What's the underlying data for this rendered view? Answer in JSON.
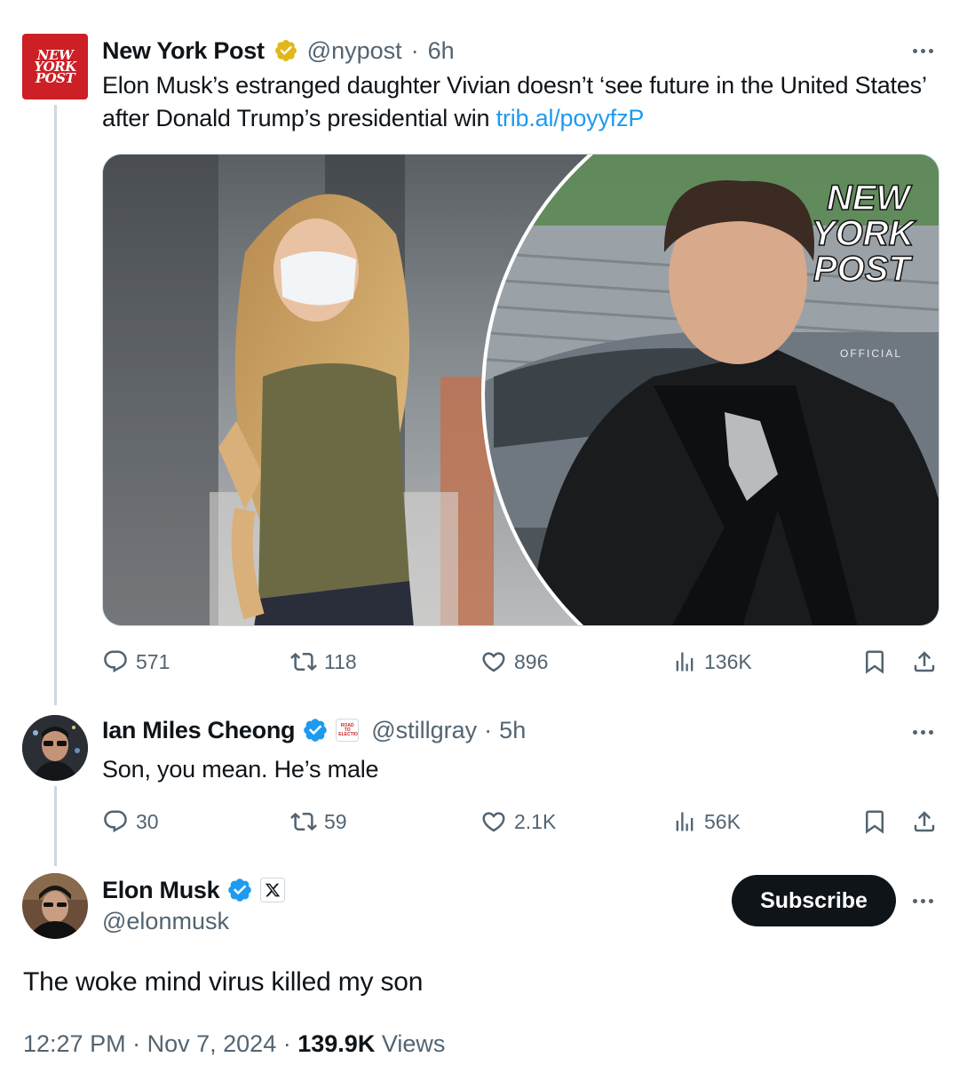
{
  "post1": {
    "display_name": "New York Post",
    "handle": "@nypost",
    "sep": "·",
    "time": "6h",
    "logo_text": [
      "NEW",
      "YORK",
      "POST"
    ],
    "text": "Elon Musk’s estranged daughter Vivian doesn’t ‘see future in the United States’ after Donald Trump’s presidential win ",
    "link": "trib.al/poyyfzP",
    "media_watermark": [
      "NEW",
      "YORK",
      "POST"
    ],
    "media_sign": "OFFICIAL",
    "replies": "571",
    "reposts": "118",
    "likes": "896",
    "views": "136K"
  },
  "post2": {
    "display_name": "Ian Miles Cheong",
    "affiliate_badge": "ROAD TO ELECTION",
    "handle": "@stillgray",
    "sep": "·",
    "time": "5h",
    "text": "Son, you mean. He’s male",
    "replies": "30",
    "reposts": "59",
    "likes": "2.1K",
    "views": "56K"
  },
  "post3": {
    "display_name": "Elon Musk",
    "handle": "@elonmusk",
    "subscribe_label": "Subscribe",
    "text": "The woke mind virus killed my son",
    "time": "12:27 PM",
    "sep": "·",
    "date": "Nov 7, 2024",
    "views_count": "139.9K",
    "views_label": "Views"
  },
  "colors": {
    "text": "#0f1419",
    "secondary": "#536471",
    "link": "#1d9bf0",
    "verified_gold": "#e2b719",
    "verified_blue": "#1d9bf0",
    "nypost_red": "#cc1f26"
  }
}
